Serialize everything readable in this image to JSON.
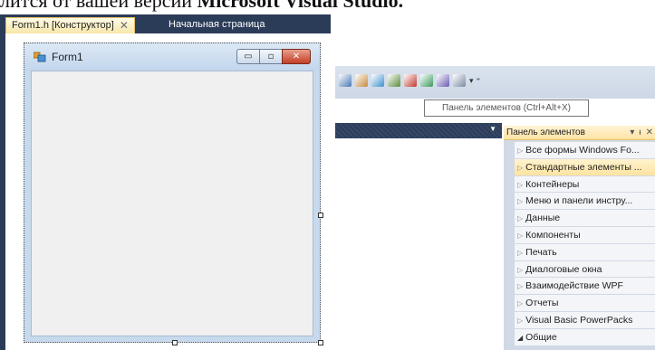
{
  "caption": {
    "prefix": "лится от вашей версии ",
    "bold": "Microsoft Visual Studio."
  },
  "tabs": [
    {
      "label": "Form1.h [Конструктор]",
      "close": "✕",
      "active": true
    },
    {
      "label": "Начальная страница",
      "active": false
    }
  ],
  "form": {
    "title": "Form1",
    "minimize": "▭",
    "maximize": "▫",
    "close": "✕"
  },
  "toolbar": {
    "icons": [
      {
        "name": "properties-icon",
        "color": "#4a78b5"
      },
      {
        "name": "object-browser-icon",
        "color": "#c58a3c"
      },
      {
        "name": "class-view-icon",
        "color": "#3f8fcf"
      },
      {
        "name": "solution-explorer-icon",
        "color": "#5a8a3a"
      },
      {
        "name": "toolbox-icon",
        "color": "#c23a2e"
      },
      {
        "name": "server-explorer-icon",
        "color": "#3a9a5a"
      },
      {
        "name": "data-sources-icon",
        "color": "#6a5ab2"
      },
      {
        "name": "output-icon",
        "color": "#7a8aa0"
      }
    ],
    "dropdown": "▾",
    "overflow": "⁼"
  },
  "tooltip": {
    "text": "Панель элементов (Ctrl+Alt+X)"
  },
  "strip": {
    "dropdown": "▼"
  },
  "toolbox": {
    "title": "Панель элементов",
    "controls": {
      "dropdown": "▾",
      "pin": "ᵼ",
      "close": "✕"
    },
    "groups": [
      {
        "label": "Все формы Windows Fo...",
        "arrow": "▷",
        "selected": false
      },
      {
        "label": "Стандартные элементы ...",
        "arrow": "▷",
        "selected": true
      },
      {
        "label": "Контейнеры",
        "arrow": "▷",
        "selected": false
      },
      {
        "label": "Меню и панели инстру...",
        "arrow": "▷",
        "selected": false
      },
      {
        "label": "Данные",
        "arrow": "▷",
        "selected": false
      },
      {
        "label": "Компоненты",
        "arrow": "▷",
        "selected": false
      },
      {
        "label": "Печать",
        "arrow": "▷",
        "selected": false
      },
      {
        "label": "Диалоговые окна",
        "arrow": "▷",
        "selected": false
      },
      {
        "label": "Взаимодействие WPF",
        "arrow": "▷",
        "selected": false
      },
      {
        "label": "Отчеты",
        "arrow": "▷",
        "selected": false
      },
      {
        "label": "Visual Basic PowerPacks",
        "arrow": "▷",
        "selected": false
      },
      {
        "label": "Общие",
        "arrow": "◢",
        "selected": false
      }
    ]
  }
}
